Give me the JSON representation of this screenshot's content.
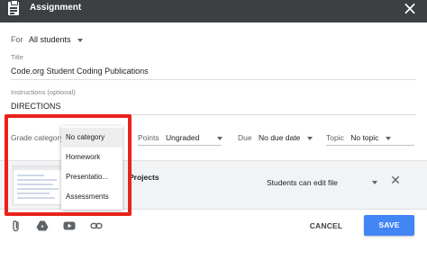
{
  "header": {
    "title": "Assignment",
    "icon": "assignment-icon",
    "close_icon": "close-icon"
  },
  "for": {
    "label": "For",
    "value": "All students"
  },
  "title_field": {
    "label": "Title",
    "value": "Code.org Student Coding Publications"
  },
  "instructions_field": {
    "label": "Instructions (optional)",
    "value": "DIRECTIONS"
  },
  "options": {
    "grade_category_label": "Grade category",
    "points_label": "Points",
    "points_value": "Ungraded",
    "due_label": "Due",
    "due_value": "No due date",
    "topic_label": "Topic",
    "topic_value": "No topic"
  },
  "dropdown": {
    "items": [
      "No category",
      "Homework",
      "Presentatio...",
      "Assessments"
    ],
    "selected": "No category"
  },
  "attachment": {
    "name_visible": "Projects",
    "permission": "Students can edit file",
    "remove_icon": "close-icon"
  },
  "toolbar": {
    "icons": [
      "paperclip-icon",
      "google-drive-icon",
      "youtube-icon",
      "link-icon"
    ],
    "cancel_label": "CANCEL",
    "save_label": "SAVE"
  },
  "colors": {
    "header": "#3c4043",
    "save": "#4285f4",
    "highlight": "#e8221b"
  }
}
